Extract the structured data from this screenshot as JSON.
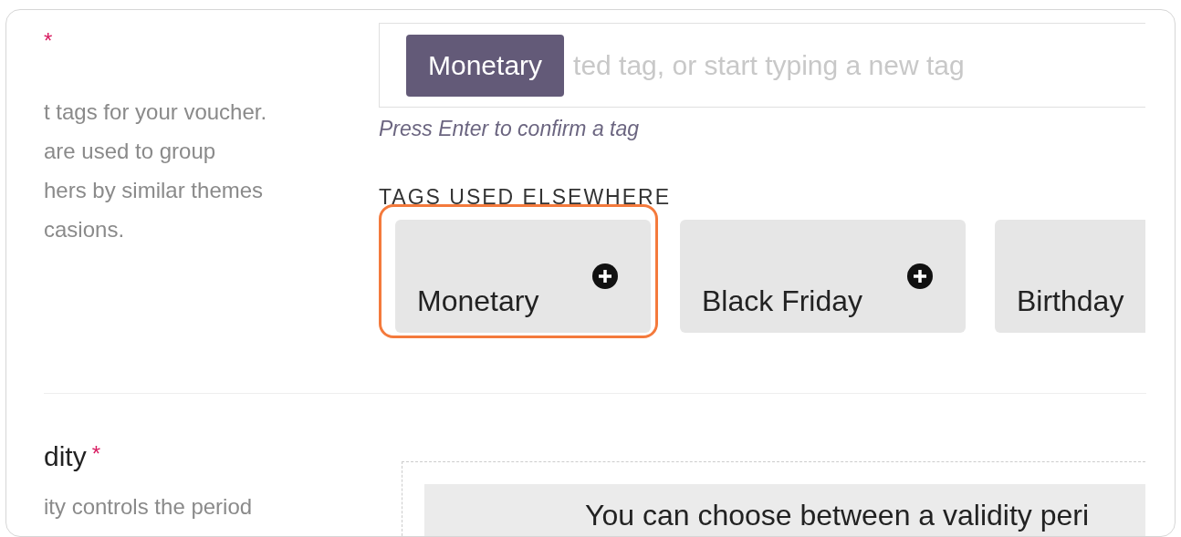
{
  "tags_section": {
    "required_mark": "*",
    "description_lines": [
      "t tags for your voucher.",
      "are used to group",
      "hers by similar themes",
      "casions."
    ],
    "tag_input": {
      "chips": [
        {
          "label": "Monetary"
        }
      ],
      "placeholder": "ted tag, or start typing a new tag"
    },
    "hint": "Press Enter to confirm a tag",
    "used_elsewhere_heading": "TAGS USED ELSEWHERE",
    "used_tags": [
      {
        "label": "Monetary",
        "highlighted": true
      },
      {
        "label": "Black Friday",
        "highlighted": false
      },
      {
        "label": "Birthday",
        "highlighted": false
      }
    ]
  },
  "validity_section": {
    "title": "dity",
    "required_mark": "*",
    "description": "ity controls the period",
    "banner": "You can choose between a validity peri"
  }
}
